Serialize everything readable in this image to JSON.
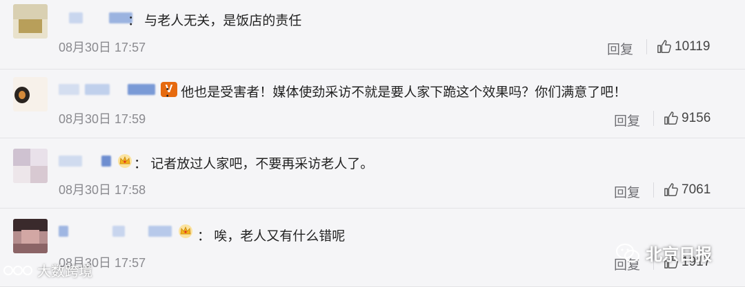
{
  "comments": [
    {
      "text": "：  与老人无关，是饭店的责任",
      "time": "08月30日 17:57",
      "reply": "回复",
      "likes": "10119",
      "badge": "none"
    },
    {
      "text": "：  他也是受害者！媒体使劲采访不就是要人家下跪这个效果吗？你们满意了吧！",
      "time": "08月30日 17:59",
      "reply": "回复",
      "likes": "9156",
      "badge": "v-icon"
    },
    {
      "text": "：  记者放过人家吧，不要再采访老人了。",
      "time": "08月30日 17:58",
      "reply": "回复",
      "likes": "7061",
      "badge": "crown-icon"
    },
    {
      "text": "：  唉，老人又有什么错呢",
      "time": "08月30日 17:57",
      "reply": "回复",
      "likes": "1917",
      "badge": "crown-icon"
    }
  ],
  "badge_v_label": "V",
  "watermarks": {
    "left": "大数跨境",
    "right": "北京日报"
  },
  "colors": {
    "background": "#f5f5f7",
    "v_badge": "#e66a0f",
    "crown": "#f2b21a"
  }
}
